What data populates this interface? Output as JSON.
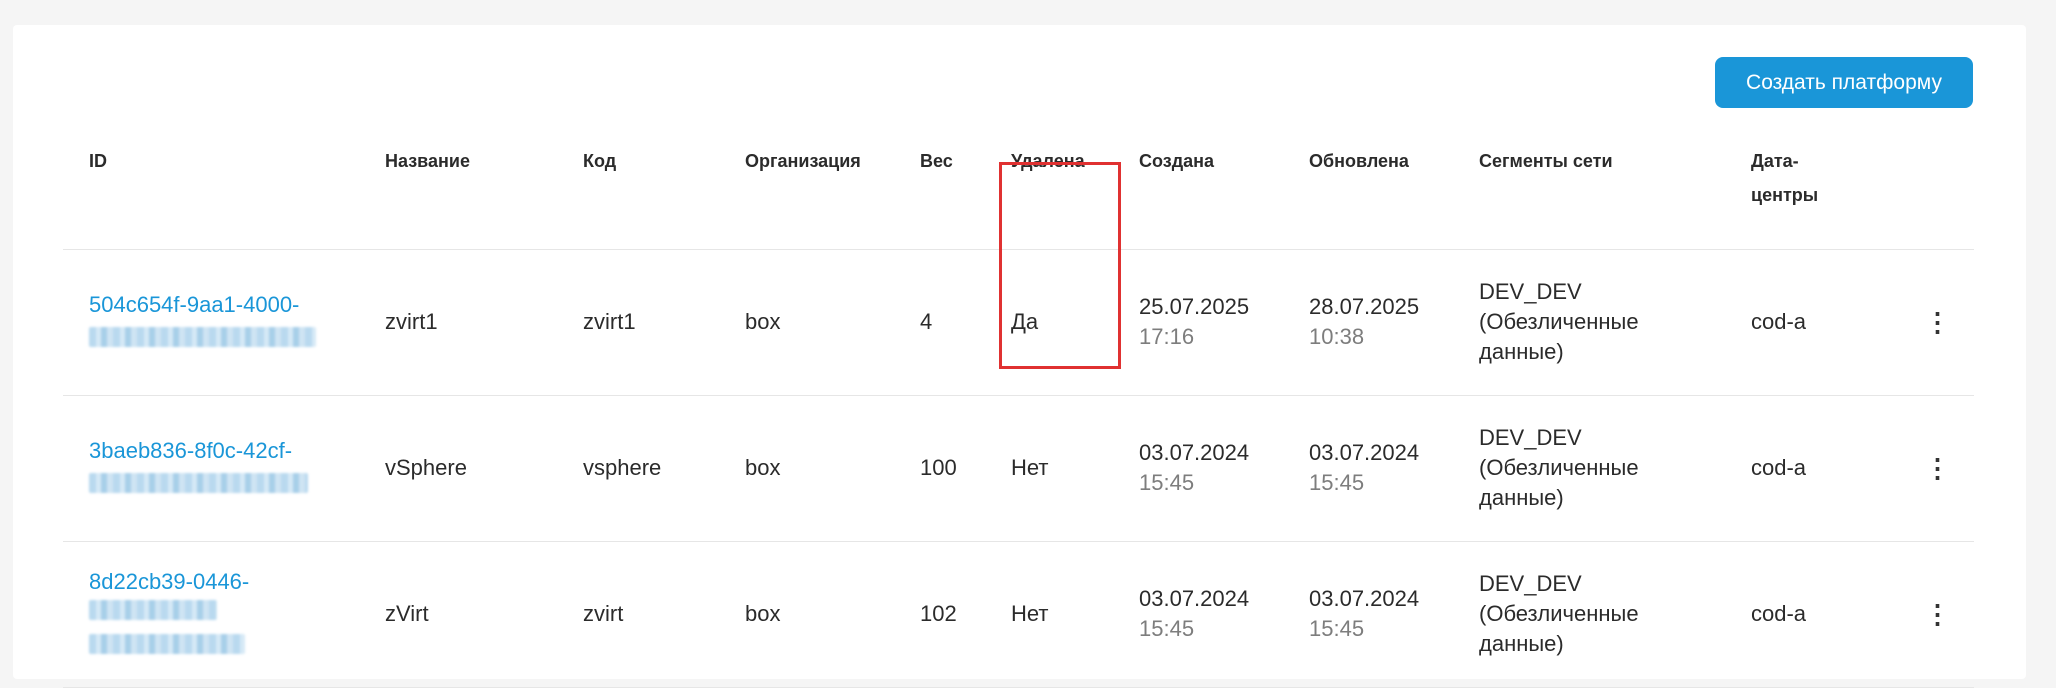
{
  "toolbar": {
    "create_label": "Создать платформу"
  },
  "columns": {
    "id": "ID",
    "name": "Название",
    "code": "Код",
    "org": "Организация",
    "weight": "Вес",
    "deleted": "Удалена",
    "created": "Создана",
    "updated": "Обновлена",
    "segments": "Сегменты сети",
    "datacenters": "Дата-центры"
  },
  "rows": [
    {
      "id_visible": "504c654f-9aa1-4000-",
      "name": "zvirt1",
      "code": "zvirt1",
      "org": "box",
      "weight": "4",
      "deleted": "Да",
      "created_date": "25.07.2025",
      "created_time": "17:16",
      "updated_date": "28.07.2025",
      "updated_time": "10:38",
      "segment_line1": "DEV_DEV",
      "segment_line2": "(Обезличенные",
      "segment_line3": "данные)",
      "datacenter": "cod-a"
    },
    {
      "id_visible": "3baeb836-8f0c-42cf-",
      "name": "vSphere",
      "code": "vsphere",
      "org": "box",
      "weight": "100",
      "deleted": "Нет",
      "created_date": "03.07.2024",
      "created_time": "15:45",
      "updated_date": "03.07.2024",
      "updated_time": "15:45",
      "segment_line1": "DEV_DEV",
      "segment_line2": "(Обезличенные",
      "segment_line3": "данные)",
      "datacenter": "cod-a"
    },
    {
      "id_visible": "8d22cb39-0446-",
      "name": "zVirt",
      "code": "zvirt",
      "org": "box",
      "weight": "102",
      "deleted": "Нет",
      "created_date": "03.07.2024",
      "created_time": "15:45",
      "updated_date": "03.07.2024",
      "updated_time": "15:45",
      "segment_line1": "DEV_DEV",
      "segment_line2": "(Обезличенные",
      "segment_line3": "данные)",
      "datacenter": "cod-a"
    }
  ],
  "icons": {
    "row_menu": "more-vertical-icon"
  },
  "colors": {
    "accent": "#1a96d8",
    "highlight": "#e03131"
  }
}
